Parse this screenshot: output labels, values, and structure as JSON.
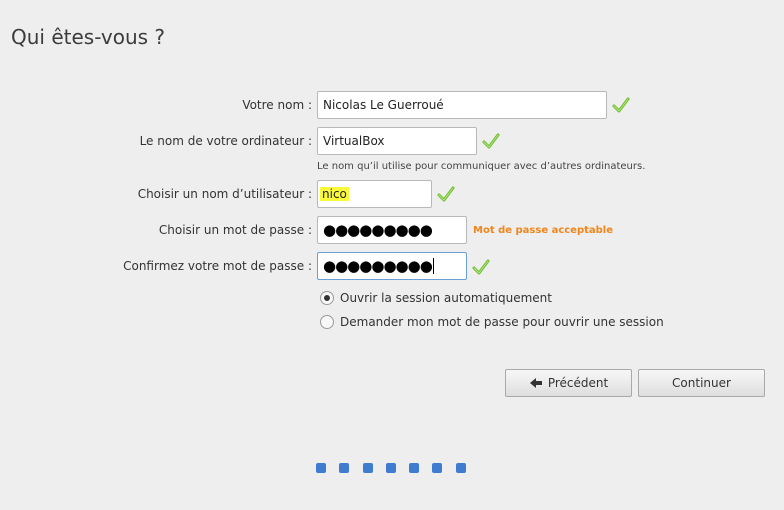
{
  "page": {
    "title": "Qui êtes-vous ?"
  },
  "form": {
    "name_label": "Votre nom :",
    "name_value": "Nicolas Le Guerroué",
    "computer_label": "Le nom de votre ordinateur :",
    "computer_value": "VirtualBox",
    "computer_hint": "Le nom qu’il utilise pour communiquer avec d’autres ordinateurs.",
    "username_label": "Choisir un nom d’utilisateur :",
    "username_value": "nico",
    "password_label": "Choisir un mot de passe :",
    "password_masked": "●●●●●●●●●",
    "password_strength": "Mot de passe acceptable",
    "confirm_label": "Confirmez votre mot de passe :",
    "confirm_masked": "●●●●●●●●●"
  },
  "login_options": {
    "auto_login": "Ouvrir la session automatiquement",
    "require_password": "Demander mon mot de passe pour ouvrir une session",
    "selected": "auto_login"
  },
  "buttons": {
    "back_label": "Précédent",
    "continue_label": "Continuer"
  },
  "pager": {
    "steps": 7
  },
  "icons": {
    "valid": "check-icon",
    "back": "arrow-left-icon"
  },
  "colors": {
    "check": "#6cbf2a",
    "strength": "#f0851a",
    "pager_dot": "#3f7cd0",
    "highlight": "#fbfa3a"
  }
}
